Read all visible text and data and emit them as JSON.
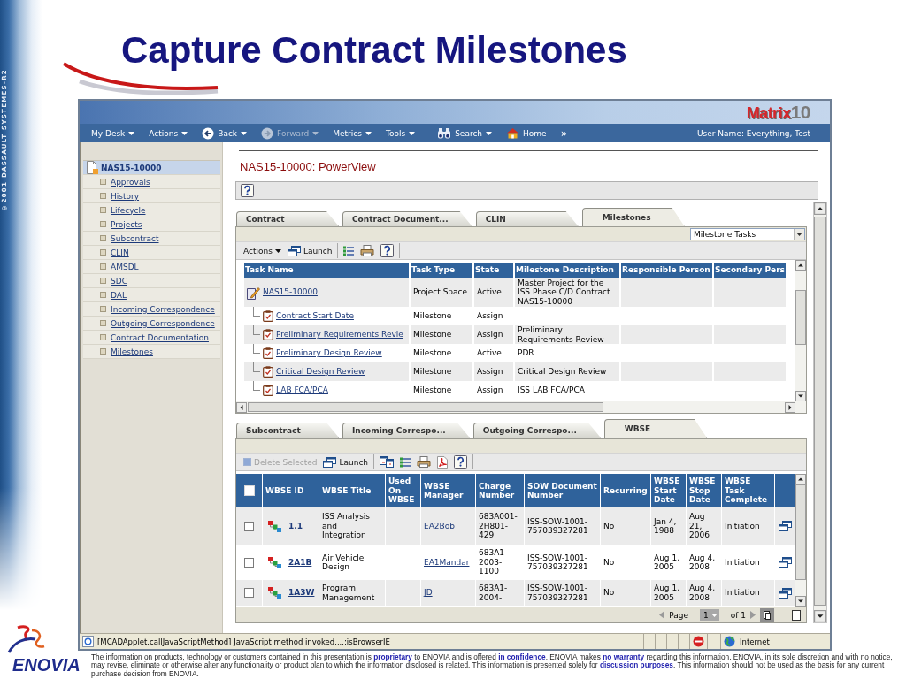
{
  "slide": {
    "title": "Capture Contract Milestones",
    "side_text": "©2001 DASSAULT SYSTEMES-R2",
    "brand": "ENOVIA",
    "disclaimer": "The information on products, technology or customers contained in this presentation is **proprietary** to ENOVIA and is offered **in confidence**. ENOVIA makes **no warranty** regarding this information. ENOVIA, in its sole discretion and with no notice, may revise, eliminate or otherwise alter any functionality or product plan to which the information disclosed is related. This information is presented solely for **discussion purposes**. This information should not be used as the basis for any current purchase decision from ENOVIA."
  },
  "window": {
    "logo": {
      "name": "Matrix",
      "version": "10"
    },
    "nav": [
      {
        "kind": "menu",
        "label": "My Desk",
        "dropdown": true,
        "disabled": false
      },
      {
        "kind": "menu",
        "label": "Actions",
        "dropdown": true,
        "disabled": false
      },
      {
        "kind": "back",
        "label": "Back",
        "dropdown": true,
        "disabled": false
      },
      {
        "kind": "forward",
        "label": "Forward",
        "dropdown": true,
        "disabled": true
      },
      {
        "kind": "menu",
        "label": "Metrics",
        "dropdown": true,
        "disabled": false
      },
      {
        "kind": "menu",
        "label": "Tools",
        "dropdown": true,
        "disabled": false
      },
      {
        "kind": "search",
        "label": "Search",
        "dropdown": true,
        "disabled": false
      },
      {
        "kind": "home",
        "label": "Home",
        "dropdown": false,
        "disabled": false
      },
      {
        "kind": "more",
        "label": "»",
        "dropdown": false,
        "disabled": false
      }
    ],
    "user": "User Name: Everything, Test"
  },
  "sidebar": {
    "root": {
      "label": "NAS15-10000",
      "selected": true
    },
    "items": [
      {
        "label": "Approvals",
        "selected": false
      },
      {
        "label": "History",
        "selected": false
      },
      {
        "label": "Lifecycle",
        "selected": false
      },
      {
        "label": "Projects",
        "selected": false
      },
      {
        "label": "Subcontract",
        "selected": false
      },
      {
        "label": "CLIN",
        "selected": false
      },
      {
        "label": "AMSDL",
        "selected": false
      },
      {
        "label": "SDC",
        "selected": false
      },
      {
        "label": "DAL",
        "selected": false
      },
      {
        "label": "Incoming Correspondence",
        "selected": false
      },
      {
        "label": "Outgoing Correspondence",
        "selected": false
      },
      {
        "label": "Contract Documentation",
        "selected": false
      },
      {
        "label": "Milestones",
        "selected": false
      }
    ]
  },
  "page": {
    "title": "NAS15-10000: PowerView"
  },
  "milestones_panel": {
    "tabs": [
      {
        "label": "Contract",
        "selected": false
      },
      {
        "label": "Contract Document...",
        "selected": false
      },
      {
        "label": "CLIN",
        "selected": false
      },
      {
        "label": "Milestones",
        "selected": true
      }
    ],
    "view": "Milestone Tasks",
    "toolbar": [
      {
        "items": [
          {
            "kind": "menu",
            "label": "Actions",
            "disabled": false
          },
          {
            "kind": "launch",
            "label": "Launch",
            "disabled": false
          }
        ]
      },
      {
        "items": [
          {
            "kind": "checklist",
            "disabled": false
          },
          {
            "kind": "print",
            "disabled": false
          },
          {
            "kind": "help",
            "disabled": false
          }
        ]
      }
    ],
    "columns": [
      "Task Name",
      "Task Type",
      "State",
      "Milestone Description",
      "Responsible Person",
      "Secondary Pers"
    ],
    "rows": [
      {
        "kind": "project",
        "name": "NAS15-10000",
        "type": "Project Space",
        "state": "Active",
        "description": "Master Project for the ISS Phase C/D Contract NAS15-10000",
        "children": [
          {
            "kind": "milestone",
            "name": "Contract Start Date",
            "type": "Milestone",
            "state": "Assign"
          },
          {
            "kind": "milestone",
            "name": "Preliminary Requirements Revie",
            "type": "Milestone",
            "state": "Assign",
            "description": "Preliminary Requirements Review"
          },
          {
            "kind": "milestone",
            "name": "Preliminary Design Review",
            "type": "Milestone",
            "state": "Active",
            "description": "PDR"
          },
          {
            "kind": "milestone",
            "name": "Critical Design Review",
            "type": "Milestone",
            "state": "Assign",
            "description": "Critical Design Review"
          },
          {
            "kind": "milestone",
            "name": "LAB FCA/PCA",
            "type": "Milestone",
            "state": "Assign",
            "description": "ISS LAB FCA/PCA"
          }
        ]
      }
    ]
  },
  "wbse_panel": {
    "tabs": [
      {
        "label": "Subcontract",
        "selected": false
      },
      {
        "label": "Incoming Correspo...",
        "selected": false
      },
      {
        "label": "Outgoing Correspo...",
        "selected": false
      },
      {
        "label": "WBSE",
        "selected": true
      }
    ],
    "toolbar": [
      {
        "items": [
          {
            "kind": "delete",
            "label": "Delete Selected",
            "disabled": true
          },
          {
            "kind": "launch",
            "label": "Launch",
            "disabled": false
          }
        ]
      },
      {
        "items": [
          {
            "kind": "convert",
            "disabled": false
          },
          {
            "kind": "checklist",
            "disabled": false
          },
          {
            "kind": "print",
            "disabled": false
          },
          {
            "kind": "pdf",
            "disabled": false
          },
          {
            "kind": "help",
            "disabled": false
          }
        ]
      }
    ],
    "select_all": {
      "checked": false
    },
    "columns": [
      "WBSE ID",
      "WBSE Title",
      "Used On WBSE",
      "WBSE Manager",
      "Charge Number",
      "SOW Document Number",
      "Recurring",
      "WBSE Start Date",
      "WBSE Stop Date",
      "WBSE Task Complete"
    ],
    "rows": [
      {
        "checked": false,
        "id": "1.1",
        "title": "ISS Analysis and Integration",
        "manager": "EA2Bob",
        "charge_number": "683A001-2H801-429",
        "sow_number": "ISS-SOW-1001-757039327281",
        "recurring": "No",
        "start": "Jan 4, 1988",
        "stop": "Aug 21, 2006",
        "task_complete": "Initiation"
      },
      {
        "checked": false,
        "id": "2A1B",
        "title": "Air Vehicle Design",
        "manager": "EA1Mandar",
        "charge_number": "683A1-2003-1100",
        "sow_number": "ISS-SOW-1001-757039327281",
        "recurring": "No",
        "start": "Aug 1, 2005",
        "stop": "Aug 4, 2008",
        "task_complete": "Initiation"
      },
      {
        "checked": false,
        "id": "1A3W",
        "title": "Program Management",
        "manager": "JD",
        "charge_number": "683A1-2004-",
        "sow_number": "ISS-SOW-1001-757039327281",
        "recurring": "No",
        "start": "Aug 1, 2005",
        "stop": "Aug 4, 2008",
        "task_complete": "Initiation"
      }
    ],
    "pager": {
      "label": "Page",
      "page": "1",
      "total": "of 1"
    }
  },
  "status_bar": {
    "message": "[MCADApplet.callJavaScriptMethod] JavaScript method invoked....:isBrowserIE",
    "zone": "Internet"
  }
}
